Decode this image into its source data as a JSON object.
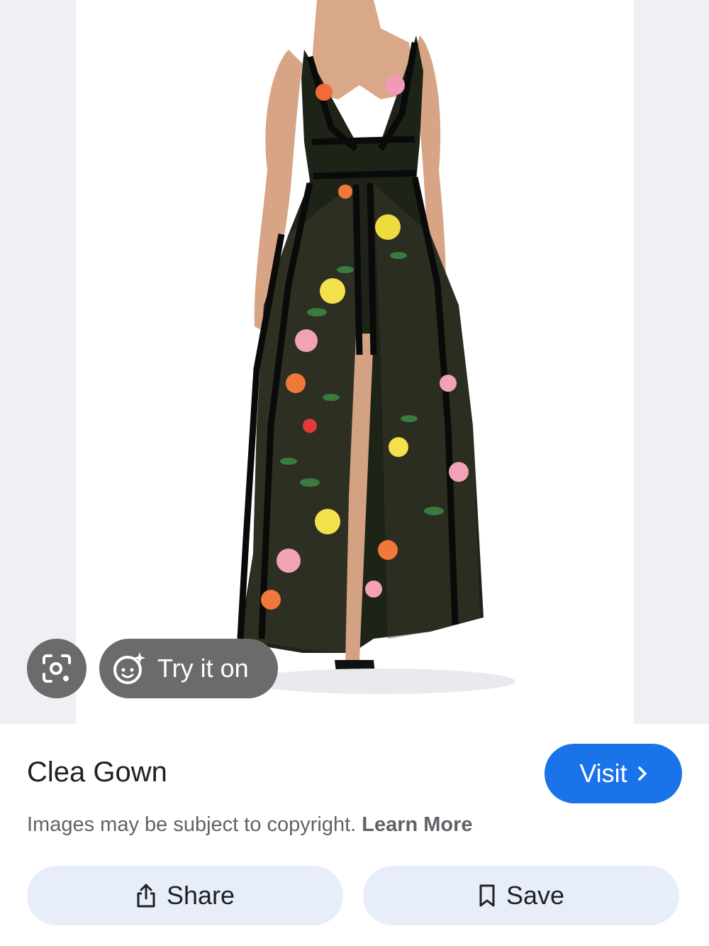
{
  "image": {
    "description_icon": "floral-gown-product-photo"
  },
  "overlay": {
    "lens_icon": "google-lens-icon",
    "try_on_label": "Try it on",
    "try_on_icon": "sparkle-face-icon"
  },
  "product": {
    "title": "Clea Gown",
    "visit_label": "Visit"
  },
  "notice": {
    "text": "Images may be subject to copyright.",
    "link": "Learn More"
  },
  "actions": {
    "share_label": "Share",
    "save_label": "Save"
  },
  "colors": {
    "accent": "#1a73e8",
    "action_bg": "#e7eef9",
    "overlay_bg": "#6b6b6b"
  }
}
